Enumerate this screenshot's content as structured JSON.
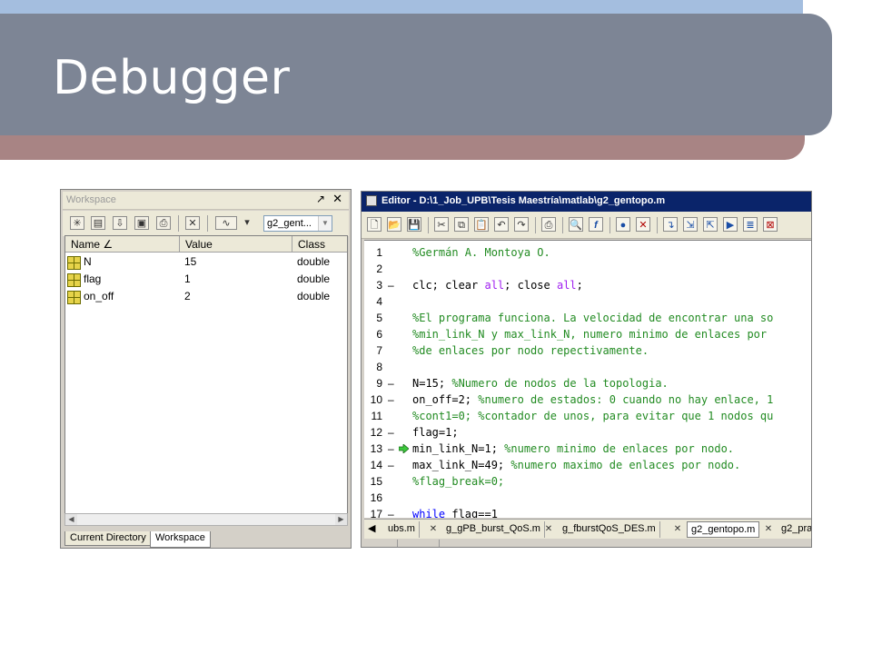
{
  "slide": {
    "title": "Debugger"
  },
  "workspace": {
    "title": "Workspace",
    "undock_glyph": "↗",
    "close_glyph": "✕",
    "combo_value": "g2_gent...",
    "columns": [
      "Name ∠",
      "Value",
      "Class"
    ],
    "rows": [
      {
        "name": "N",
        "value": "15",
        "class": "double"
      },
      {
        "name": "flag",
        "value": "1",
        "class": "double"
      },
      {
        "name": "on_off",
        "value": "2",
        "class": "double"
      }
    ],
    "tabs": [
      "Current Directory",
      "Workspace"
    ]
  },
  "editor": {
    "title": "Editor - D:\\1_Job_UPB\\Tesis Maestría\\matlab\\g2_gentopo.m",
    "lines": [
      {
        "n": "1",
        "m": "",
        "segs": [
          [
            "cm",
            "%Germán A. Montoya O."
          ]
        ]
      },
      {
        "n": "2",
        "m": "",
        "segs": []
      },
      {
        "n": "3",
        "m": "–",
        "segs": [
          [
            "tx",
            "clc; clear "
          ],
          [
            "str",
            "all"
          ],
          [
            "tx",
            "; close "
          ],
          [
            "str",
            "all"
          ],
          [
            "tx",
            ";"
          ]
        ]
      },
      {
        "n": "4",
        "m": "",
        "segs": []
      },
      {
        "n": "5",
        "m": "",
        "segs": [
          [
            "cm",
            "%El programa funciona. La velocidad de encontrar una so"
          ]
        ]
      },
      {
        "n": "6",
        "m": "",
        "segs": [
          [
            "cm",
            "%min_link_N y max_link_N, numero minimo de enlaces por"
          ]
        ]
      },
      {
        "n": "7",
        "m": "",
        "segs": [
          [
            "cm",
            "%de enlaces por nodo repectivamente."
          ]
        ]
      },
      {
        "n": "8",
        "m": "",
        "segs": []
      },
      {
        "n": "9",
        "m": "–",
        "segs": [
          [
            "tx",
            "N=15; "
          ],
          [
            "cm",
            "%Numero de nodos de la topologia."
          ]
        ]
      },
      {
        "n": "10",
        "m": "–",
        "segs": [
          [
            "tx",
            "on_off=2; "
          ],
          [
            "cm",
            "%numero de estados: 0 cuando no hay enlace, 1"
          ]
        ]
      },
      {
        "n": "11",
        "m": "",
        "segs": [
          [
            "cm",
            "%cont1=0; %contador de unos, para evitar que 1 nodos qu"
          ]
        ]
      },
      {
        "n": "12",
        "m": "–",
        "segs": [
          [
            "tx",
            "flag=1;"
          ]
        ]
      },
      {
        "n": "13",
        "m": "–",
        "arrow": true,
        "segs": [
          [
            "tx",
            "min_link_N=1; "
          ],
          [
            "cm",
            "%numero minimo de enlaces por nodo."
          ]
        ]
      },
      {
        "n": "14",
        "m": "–",
        "segs": [
          [
            "tx",
            "max_link_N=49; "
          ],
          [
            "cm",
            "%numero maximo de enlaces por nodo."
          ]
        ]
      },
      {
        "n": "15",
        "m": "",
        "segs": [
          [
            "cm",
            "%flag_break=0;"
          ]
        ]
      },
      {
        "n": "16",
        "m": "",
        "segs": []
      },
      {
        "n": "17",
        "m": "–",
        "segs": [
          [
            "kw",
            "while"
          ],
          [
            "tx",
            " flag==1"
          ]
        ]
      }
    ],
    "tab_nav": "◀",
    "tabs": [
      "ubs.m",
      "g_gPB_burst_QoS.m",
      "g_fburstQoS_DES.m",
      "g2_gentopo.m",
      "g2_pra"
    ],
    "active_tab": 3
  }
}
